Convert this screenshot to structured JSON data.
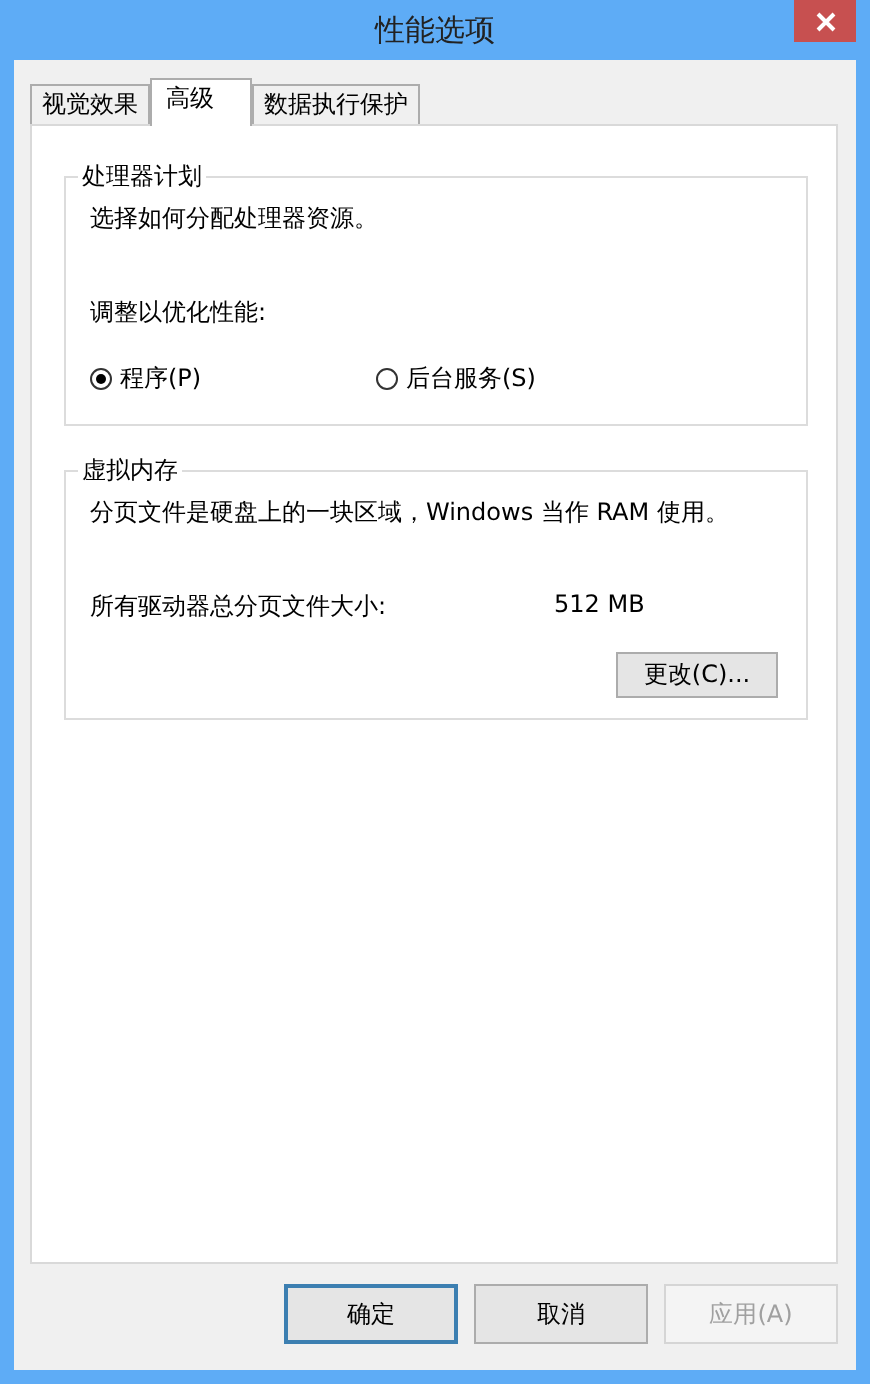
{
  "window": {
    "title": "性能选项"
  },
  "tabs": [
    {
      "label": "视觉效果",
      "selected": false
    },
    {
      "label": "高级",
      "selected": true
    },
    {
      "label": "数据执行保护",
      "selected": false
    }
  ],
  "processor_group": {
    "title": "处理器计划",
    "description": "选择如何分配处理器资源。",
    "adjust_label": "调整以优化性能:",
    "options": [
      {
        "label": "程序(P)",
        "selected": true
      },
      {
        "label": "后台服务(S)",
        "selected": false
      }
    ]
  },
  "memory_group": {
    "title": "虚拟内存",
    "description": "分页文件是硬盘上的一块区域，Windows 当作 RAM 使用。",
    "size_label": "所有驱动器总分页文件大小:",
    "size_value": "512 MB",
    "change_button": "更改(C)..."
  },
  "buttons": [
    {
      "label": "确定",
      "disabled": false,
      "default": true
    },
    {
      "label": "取消",
      "disabled": false,
      "default": false
    },
    {
      "label": "应用(A)",
      "disabled": true,
      "default": false
    }
  ]
}
